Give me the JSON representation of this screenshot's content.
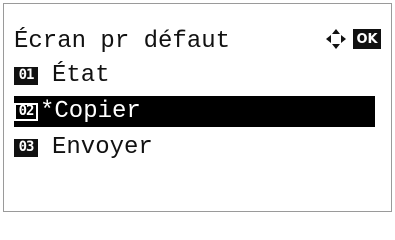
{
  "header": {
    "title": "Écran pr défaut",
    "nav_icon": "four-way-arrow-icon",
    "ok_label": "OK"
  },
  "menu": {
    "items": [
      {
        "number": "01",
        "label": "État",
        "selected": false
      },
      {
        "number": "02",
        "label": "*Copier",
        "selected": true
      },
      {
        "number": "03",
        "label": "Envoyer",
        "selected": false
      }
    ]
  },
  "colors": {
    "background": "#ffffff",
    "text": "#111111",
    "highlight": "#000000"
  }
}
